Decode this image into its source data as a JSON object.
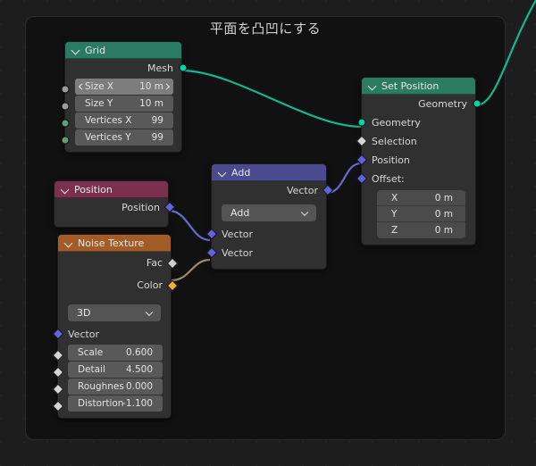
{
  "editor": {
    "title": "平面を凸凹にする",
    "background_color": "#1d1d1d",
    "frame_color": "#111111"
  },
  "colors": {
    "header_geometry": "#2b7b62",
    "header_vector_math": "#4a4a8f",
    "header_input": "#7c3050",
    "header_texture": "#a35c28",
    "socket_geometry": "#00d6a3",
    "socket_vector": "#6363d8",
    "socket_color": "#e7b13a",
    "socket_float": "#9d9d9d",
    "socket_int": "#5f9e7c",
    "wire_geometry": "#10b891",
    "wire_vector": "#6a6ac8"
  },
  "nodes": {
    "grid": {
      "title": "Grid",
      "outputs": [
        {
          "label": "Mesh",
          "type": "geometry"
        }
      ],
      "fields": [
        {
          "name": "Size X",
          "value": "10 m",
          "active": true
        },
        {
          "name": "Size Y",
          "value": "10 m",
          "active": false
        },
        {
          "name": "Vertices X",
          "value": "99",
          "active": false
        },
        {
          "name": "Vertices Y",
          "value": "99",
          "active": false
        }
      ]
    },
    "set_position": {
      "title": "Set Position",
      "outputs": [
        {
          "label": "Geometry",
          "type": "geometry"
        }
      ],
      "inputs": [
        {
          "label": "Geometry",
          "type": "geometry"
        },
        {
          "label": "Selection",
          "type": "boolean"
        },
        {
          "label": "Position",
          "type": "vector"
        },
        {
          "label": "Offset:",
          "type": "vector"
        }
      ],
      "offset": [
        {
          "axis": "X",
          "value": "0 m"
        },
        {
          "axis": "Y",
          "value": "0 m"
        },
        {
          "axis": "Z",
          "value": "0 m"
        }
      ]
    },
    "add": {
      "title": "Add",
      "outputs": [
        {
          "label": "Vector",
          "type": "vector"
        }
      ],
      "operation": "Add",
      "inputs": [
        {
          "label": "Vector",
          "type": "vector"
        },
        {
          "label": "Vector",
          "type": "vector"
        }
      ]
    },
    "position": {
      "title": "Position",
      "outputs": [
        {
          "label": "Position",
          "type": "vector"
        }
      ]
    },
    "noise_texture": {
      "title": "Noise Texture",
      "outputs": [
        {
          "label": "Fac",
          "type": "float"
        },
        {
          "label": "Color",
          "type": "color"
        }
      ],
      "dimension": "3D",
      "vector_input": "Vector",
      "fields": [
        {
          "name": "Scale",
          "value": "0.600"
        },
        {
          "name": "Detail",
          "value": "4.500"
        },
        {
          "name": "Roughnes",
          "value": "0.000"
        },
        {
          "name": "Distortion",
          "value": "-1.100"
        }
      ]
    }
  },
  "links": [
    {
      "from": "grid.Mesh",
      "to": "set_position.Geometry"
    },
    {
      "from": "position.Position",
      "to": "add.Vector1"
    },
    {
      "from": "noise_texture.Color",
      "to": "add.Vector2"
    },
    {
      "from": "add.Vector",
      "to": "set_position.Position"
    },
    {
      "from": "set_position.Geometry",
      "to": "offscreen"
    }
  ]
}
